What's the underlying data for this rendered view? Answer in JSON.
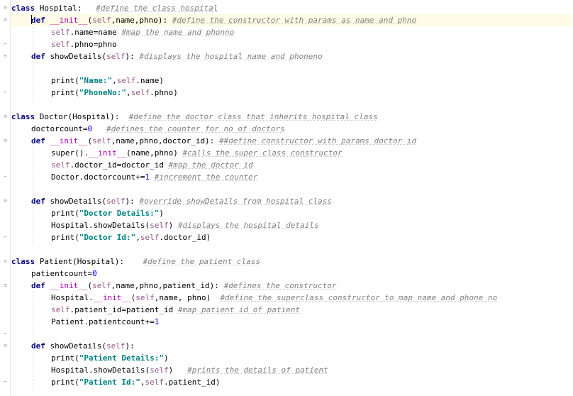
{
  "editor": {
    "language": "python",
    "caret_line": 2,
    "lines": [
      {
        "indent": 0,
        "tokens": [
          {
            "t": "kw",
            "v": "class"
          },
          {
            "t": "p",
            "v": " Hospital:   "
          },
          {
            "t": "cm",
            "v": "#define the class hospital"
          }
        ]
      },
      {
        "indent": 1,
        "tokens": [
          {
            "t": "kw",
            "v": "def"
          },
          {
            "t": "p",
            "v": " "
          },
          {
            "t": "dunder",
            "v": "__init__"
          },
          {
            "t": "p",
            "v": "("
          },
          {
            "t": "self",
            "v": "self"
          },
          {
            "t": "p",
            "v": ",name,phno): "
          },
          {
            "t": "cm",
            "v": "#define the constructor with params as name and phno"
          }
        ]
      },
      {
        "indent": 2,
        "tokens": [
          {
            "t": "self",
            "v": "self"
          },
          {
            "t": "p",
            "v": ".name=name "
          },
          {
            "t": "cm",
            "v": "#map the name and phonno"
          }
        ]
      },
      {
        "indent": 2,
        "tokens": [
          {
            "t": "self",
            "v": "self"
          },
          {
            "t": "p",
            "v": ".phno=phno"
          }
        ]
      },
      {
        "indent": 1,
        "tokens": [
          {
            "t": "kw",
            "v": "def"
          },
          {
            "t": "p",
            "v": " showDetails("
          },
          {
            "t": "self",
            "v": "self"
          },
          {
            "t": "p",
            "v": "): "
          },
          {
            "t": "cm",
            "v": "#displays the hospital name and phoneno"
          }
        ]
      },
      {
        "indent": 0,
        "tokens": []
      },
      {
        "indent": 2,
        "tokens": [
          {
            "t": "p",
            "v": "print("
          },
          {
            "t": "str",
            "v": "\"Name:\""
          },
          {
            "t": "p",
            "v": ","
          },
          {
            "t": "self",
            "v": "self"
          },
          {
            "t": "p",
            "v": ".name)"
          }
        ]
      },
      {
        "indent": 2,
        "tokens": [
          {
            "t": "p",
            "v": "print("
          },
          {
            "t": "str",
            "v": "\"PhoneNo:\""
          },
          {
            "t": "p",
            "v": ","
          },
          {
            "t": "self",
            "v": "self"
          },
          {
            "t": "p",
            "v": ".phno)"
          }
        ]
      },
      {
        "indent": 0,
        "tokens": []
      },
      {
        "indent": 0,
        "tokens": [
          {
            "t": "kw",
            "v": "class"
          },
          {
            "t": "p",
            "v": " Doctor(Hospital):  "
          },
          {
            "t": "cm",
            "v": "#define the doctor class that inherits hospital class"
          }
        ]
      },
      {
        "indent": 1,
        "tokens": [
          {
            "t": "p",
            "v": "doctorcount="
          },
          {
            "t": "num",
            "v": "0"
          },
          {
            "t": "p",
            "v": "   "
          },
          {
            "t": "cm",
            "v": "#defines the counter for no of doctors"
          }
        ]
      },
      {
        "indent": 1,
        "tokens": [
          {
            "t": "kw",
            "v": "def"
          },
          {
            "t": "p",
            "v": " "
          },
          {
            "t": "dunder",
            "v": "__init__"
          },
          {
            "t": "p",
            "v": "("
          },
          {
            "t": "self",
            "v": "self"
          },
          {
            "t": "p",
            "v": ",name,phno,doctor_id): "
          },
          {
            "t": "cm",
            "v": "##define constructor with params doctor id"
          }
        ]
      },
      {
        "indent": 2,
        "tokens": [
          {
            "t": "p",
            "v": "super()."
          },
          {
            "t": "dunder",
            "v": "__init__"
          },
          {
            "t": "p",
            "v": "(name,phno) "
          },
          {
            "t": "cm",
            "v": "#calls the super class constructor"
          }
        ]
      },
      {
        "indent": 2,
        "tokens": [
          {
            "t": "self",
            "v": "self"
          },
          {
            "t": "p",
            "v": ".doctor_id=doctor_id "
          },
          {
            "t": "cm",
            "v": "#map the doctor id"
          }
        ]
      },
      {
        "indent": 2,
        "tokens": [
          {
            "t": "p",
            "v": "Doctor.doctorcount+="
          },
          {
            "t": "num",
            "v": "1"
          },
          {
            "t": "p",
            "v": " "
          },
          {
            "t": "cm",
            "v": "#increment the counter"
          }
        ]
      },
      {
        "indent": 0,
        "tokens": []
      },
      {
        "indent": 1,
        "tokens": [
          {
            "t": "kw",
            "v": "def"
          },
          {
            "t": "p",
            "v": " showDetails("
          },
          {
            "t": "self",
            "v": "self"
          },
          {
            "t": "p",
            "v": "): "
          },
          {
            "t": "cm",
            "v": "#override showDetails from hospital class"
          }
        ]
      },
      {
        "indent": 2,
        "tokens": [
          {
            "t": "p",
            "v": "print("
          },
          {
            "t": "str",
            "v": "\"Doctor Details:\""
          },
          {
            "t": "p",
            "v": ")"
          }
        ]
      },
      {
        "indent": 2,
        "tokens": [
          {
            "t": "p",
            "v": "Hospital.showDetails("
          },
          {
            "t": "self",
            "v": "self"
          },
          {
            "t": "p",
            "v": ") "
          },
          {
            "t": "cm",
            "v": "#displays the hospital details"
          }
        ]
      },
      {
        "indent": 2,
        "tokens": [
          {
            "t": "p",
            "v": "print("
          },
          {
            "t": "str",
            "v": "\"Doctor Id:\""
          },
          {
            "t": "p",
            "v": ","
          },
          {
            "t": "self",
            "v": "self"
          },
          {
            "t": "p",
            "v": ".doctor_id)"
          }
        ]
      },
      {
        "indent": 0,
        "tokens": []
      },
      {
        "indent": 0,
        "tokens": [
          {
            "t": "kw",
            "v": "class"
          },
          {
            "t": "p",
            "v": " Patient(Hospital):    "
          },
          {
            "t": "cm",
            "v": "#define the patient class"
          }
        ]
      },
      {
        "indent": 1,
        "tokens": [
          {
            "t": "p",
            "v": "patientcount="
          },
          {
            "t": "num",
            "v": "0"
          }
        ]
      },
      {
        "indent": 1,
        "tokens": [
          {
            "t": "kw",
            "v": "def"
          },
          {
            "t": "p",
            "v": " "
          },
          {
            "t": "dunder",
            "v": "__init__"
          },
          {
            "t": "p",
            "v": "("
          },
          {
            "t": "self",
            "v": "self"
          },
          {
            "t": "p",
            "v": ",name,phno,patient_id): "
          },
          {
            "t": "cm",
            "v": "#defines the constructor"
          }
        ]
      },
      {
        "indent": 2,
        "tokens": [
          {
            "t": "p",
            "v": "Hospital."
          },
          {
            "t": "dunder",
            "v": "__init__"
          },
          {
            "t": "p",
            "v": "("
          },
          {
            "t": "self",
            "v": "self"
          },
          {
            "t": "p",
            "v": ",name, phno)  "
          },
          {
            "t": "cm",
            "v": "#define the superclass constructor to map name and phone no"
          }
        ]
      },
      {
        "indent": 2,
        "tokens": [
          {
            "t": "self",
            "v": "self"
          },
          {
            "t": "p",
            "v": ".patient_id=patient_id "
          },
          {
            "t": "cm",
            "v": "#map patient id of patient"
          }
        ]
      },
      {
        "indent": 2,
        "tokens": [
          {
            "t": "p",
            "v": "Patient.patientcount+="
          },
          {
            "t": "num",
            "v": "1"
          }
        ]
      },
      {
        "indent": 0,
        "tokens": []
      },
      {
        "indent": 1,
        "tokens": [
          {
            "t": "kw",
            "v": "def"
          },
          {
            "t": "p",
            "v": " showDetails("
          },
          {
            "t": "self",
            "v": "self"
          },
          {
            "t": "p",
            "v": "):"
          }
        ]
      },
      {
        "indent": 2,
        "tokens": [
          {
            "t": "p",
            "v": "print("
          },
          {
            "t": "str",
            "v": "\"Patient Details:\""
          },
          {
            "t": "p",
            "v": ")"
          }
        ]
      },
      {
        "indent": 2,
        "tokens": [
          {
            "t": "p",
            "v": "Hospital.showDetails("
          },
          {
            "t": "self",
            "v": "self"
          },
          {
            "t": "p",
            "v": ")   "
          },
          {
            "t": "cm",
            "v": "#prints the details of patient"
          }
        ]
      },
      {
        "indent": 2,
        "tokens": [
          {
            "t": "p",
            "v": "print("
          },
          {
            "t": "str",
            "v": "\"Patient Id:\""
          },
          {
            "t": "p",
            "v": ","
          },
          {
            "t": "self",
            "v": "self"
          },
          {
            "t": "p",
            "v": ".patient_id)"
          }
        ]
      }
    ]
  },
  "colors": {
    "keyword": "#000080",
    "self": "#94558d",
    "dunder": "#b200b2",
    "string": "#008080",
    "number": "#0000ff",
    "comment": "#808080",
    "caret_line_bg": "#fffbe6"
  },
  "icons": {
    "fold_open": "fold-open-icon",
    "fold_end": "fold-end-icon"
  }
}
